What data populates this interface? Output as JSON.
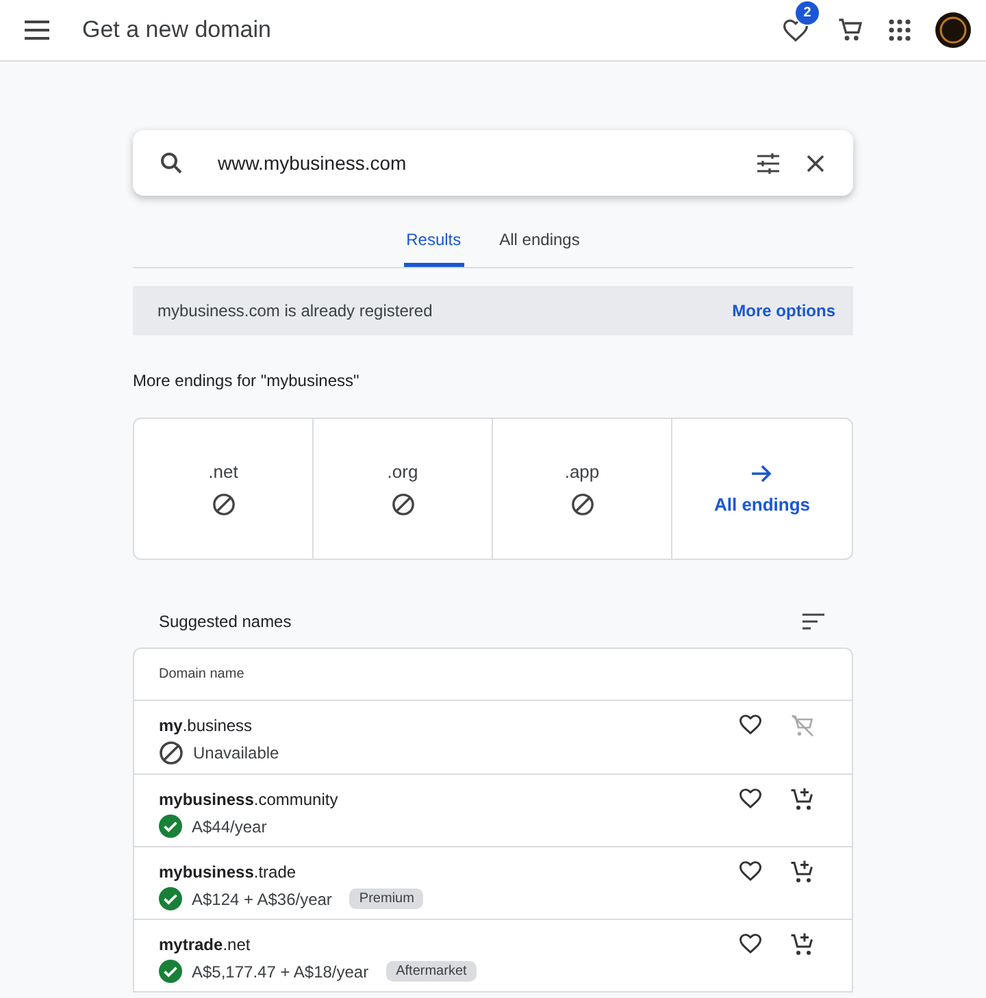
{
  "header": {
    "title": "Get a new domain",
    "favorites_count": "2"
  },
  "search": {
    "value": "www.mybusiness.com"
  },
  "tabs": [
    {
      "label": "Results",
      "selected": true
    },
    {
      "label": "All endings",
      "selected": false
    }
  ],
  "banner": {
    "message": "mybusiness.com is already registered",
    "action": "More options"
  },
  "endings": {
    "heading": "More endings for \"mybusiness\"",
    "items": [
      {
        "kind": "unavailable",
        "label": ".net"
      },
      {
        "kind": "unavailable",
        "label": ".org"
      },
      {
        "kind": "unavailable",
        "label": ".app"
      },
      {
        "kind": "link",
        "label": "All endings"
      }
    ]
  },
  "suggested": {
    "heading": "Suggested names",
    "column": "Domain name",
    "rows": [
      {
        "name": "**my**.business",
        "kind": "unavailable",
        "status": "Unavailable"
      },
      {
        "name": "**mybusiness**.community",
        "kind": "available",
        "status": "A$44/year"
      },
      {
        "name": "**mybusiness**.trade",
        "kind": "available",
        "status": "A$124 + A$36/year",
        "tag": "Premium"
      },
      {
        "name": "**mytrade**.net",
        "kind": "available",
        "status": "A$5,177.47 + A$18/year",
        "tag": "Aftermarket"
      }
    ]
  }
}
